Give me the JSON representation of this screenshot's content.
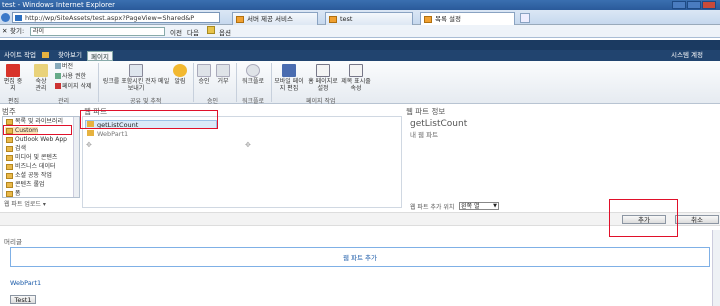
{
  "window": {
    "title": "test - Windows Internet Explorer"
  },
  "browser": {
    "address": "http://wp/SiteAssets/test.aspx?PageView=Shared&P",
    "tabs": [
      "서버 제공 서비스",
      "test",
      "목록 설정"
    ],
    "find_label": "찾기:",
    "find_value": "라이",
    "prev_label": "이전",
    "next_label": "다음",
    "options_label": "옵션"
  },
  "ribbon": {
    "tabs": [
      "사이트 작업",
      "찾아보기",
      "페이지"
    ],
    "account": "시스템 계정",
    "buttons": {
      "edit": "편집 중지",
      "manage": "숙상 관리",
      "version": "버전",
      "permissions": "사용 권한",
      "delete": "페이지 삭제",
      "email_link": "링크를 포함시킨 전자 메일 보내기",
      "alert": "알림",
      "approve": "승인",
      "reject": "거부",
      "workflow": "워크플로",
      "mobile": "모바일 페이지 편집",
      "homepage": "홈 페이지로 설정",
      "library": "제목 표시줄 속성"
    },
    "groups": [
      "편집",
      "관리",
      "공유 및 추적",
      "승인",
      "워크플로",
      "페이지 작업"
    ]
  },
  "picker": {
    "categories_title": "범주",
    "categories": [
      "목록 및 라이브러리",
      "Custom",
      "Outlook Web App",
      "검색",
      "미디어 및 콘텐츠",
      "비즈니스 데이터",
      "소셜 공동 작업",
      "콘텐츠 롤업",
      "폼"
    ],
    "upload_label": "웹 파트 업로드 ▾",
    "parts_title": "웹 파트",
    "parts": [
      "getListCount",
      "WebPart1"
    ],
    "info_title": "웹 파트 정보",
    "info_name": "getListCount",
    "info_desc": "내 웹 파트",
    "add_to_label": "웹 파트 추가 위치",
    "add_to_value": "왼쪽 열",
    "add_button": "추가",
    "cancel_button": "취소"
  },
  "page": {
    "zone_label": "머리글",
    "add_webpart": "웹 파트 추가",
    "webpart_title": "WebPart1",
    "test_button": "Test1"
  }
}
